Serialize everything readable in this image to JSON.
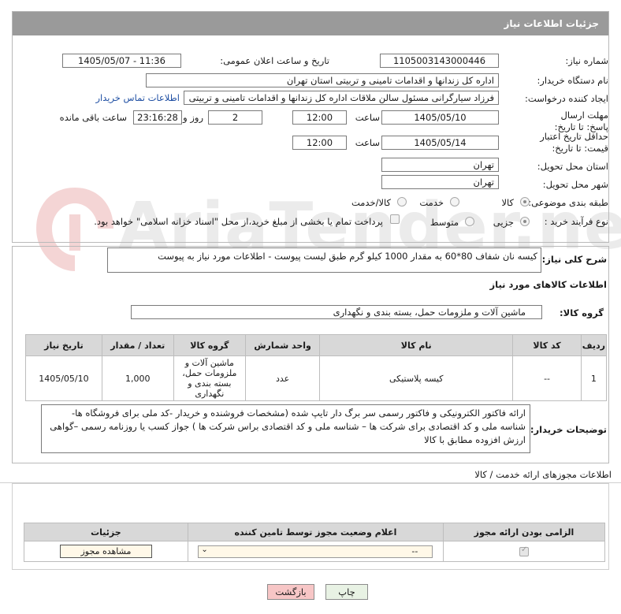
{
  "panel_title": "جزئیات اطلاعات نیاز",
  "fields": {
    "need_number_label": "شماره نیاز:",
    "need_number": "1105003143000446",
    "announce_label": "تاریخ و ساعت اعلان عمومی:",
    "announce_value": "1405/05/07 - 11:36",
    "buyer_org_label": "نام دستگاه خریدار:",
    "buyer_org": "اداره کل زندانها و اقدامات تامینی و تربیتی استان تهران",
    "requester_label": "ایجاد کننده درخواست:",
    "requester": "فرزاد سیارگرانی مسئول سالن ملاقات  اداره کل زندانها و اقدامات تامینی و تربیتی",
    "contact_link": "اطلاعات تماس خریدار",
    "deadline_label": "مهلت ارسال پاسخ: تا تاریخ:",
    "deadline_date": "1405/05/10",
    "time_label": "ساعت",
    "deadline_time": "12:00",
    "days_value": "2",
    "days_label": "روز و",
    "remaining_time": "23:16:28",
    "remaining_label": "ساعت باقی مانده",
    "validity_label": "حداقل تاریخ اعتبار قیمت: تا تاریخ:",
    "validity_date": "1405/05/14",
    "validity_time": "12:00",
    "province_label": "استان محل تحویل:",
    "province": "تهران",
    "city_label": "شهر محل تحویل:",
    "city": "تهران",
    "category_label": "طبقه بندی موضوعی:",
    "category_options": [
      "کالا",
      "خدمت",
      "کالا/خدمت"
    ],
    "process_label": "نوع فرآیند خرید :",
    "process_options": [
      "جزیی",
      "متوسط"
    ],
    "payment_note": "پرداخت تمام یا بخشی از مبلغ خرید،از محل \"اسناد خزانه اسلامی\" خواهد بود."
  },
  "description": {
    "label": "شرح کلی نیاز:",
    "text": "کیسه نان شفاف 80*60 به مقدار 1000 کیلو گرم طبق لیست پیوست - اطلاعات مورد نیاز به پیوست"
  },
  "goods_section_title": "اطلاعات کالاهای مورد نیاز",
  "goods_group": {
    "label": "گروه کالا:",
    "value": "ماشین آلات و ملزومات حمل، بسته بندی و نگهداری"
  },
  "table": {
    "headers": [
      "ردیف",
      "کد کالا",
      "نام کالا",
      "واحد شمارش",
      "گروه کالا",
      "تعداد / مقدار",
      "تاریخ نیاز"
    ],
    "rows": [
      [
        "1",
        "--",
        "کیسه پلاستیکی",
        "عدد",
        "ماشین آلات و ملزومات حمل، بسته بندی و نگهداری",
        "1,000",
        "1405/05/10"
      ]
    ]
  },
  "buyer_notes": {
    "label": "توضیحات خریدار:",
    "text": "ارائه فاکتور الکترونیکی و فاکتور رسمی سر برگ دار تایپ شده (مشخصات فروشنده و خریدار -کد ملی برای فروشگاه ها- شناسه ملی و کد اقتصادی برای شرکت ها – شناسه ملی و کد اقتصادی براس شرکت ها ) جواز کسب یا روزنامه رسمی –گواهی ارزش افزوده مطابق با کالا"
  },
  "permits": {
    "title": "اطلاعات مجوزهای ارائه خدمت / کالا",
    "headers": [
      "الزامی بودن ارائه مجوز",
      "اعلام وضعیت مجوز توسط تامین کننده",
      "جزئیات"
    ],
    "select_value": "--",
    "view_button": "مشاهده مجوز"
  },
  "buttons": {
    "print": "چاپ",
    "back": "بازگشت"
  },
  "watermark": "AriaTender.neT",
  "colors": {
    "header_bg": "#9a9a9a",
    "link": "#1f4fa3",
    "back_button": "#f7c6c6"
  }
}
